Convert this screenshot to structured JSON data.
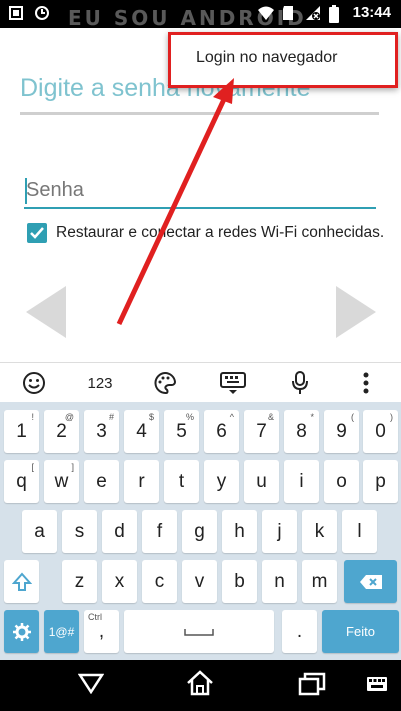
{
  "status_bar": {
    "time": "13:44",
    "left_icons": [
      "notification-icon",
      "clock-alarm-icon"
    ],
    "right_icons": [
      "wifi-icon",
      "sd-card-icon",
      "signal-no-sim-icon",
      "battery-icon"
    ],
    "watermark": "EU SOU ANDROID"
  },
  "app": {
    "title": "Digite a senha novamente",
    "password_placeholder": "Senha",
    "wifi_checkbox_label": "Restaurar e conectar a redes Wi-Fi conhecidas.",
    "wifi_checkbox_checked": true
  },
  "popup_menu": {
    "items": [
      "Login no navegador"
    ]
  },
  "keyboard_toolbar": {
    "numbers_label": "123",
    "icons": [
      "emoji-icon",
      "palette-icon",
      "keyboard-hide-icon",
      "microphone-icon",
      "more-vert-icon"
    ]
  },
  "keyboard": {
    "row1": [
      "1",
      "2",
      "3",
      "4",
      "5",
      "6",
      "7",
      "8",
      "9",
      "0"
    ],
    "row1_hints": [
      "!",
      "@",
      "#",
      "$",
      "%",
      "^",
      "&",
      "*",
      "(",
      ")"
    ],
    "row2": [
      "q",
      "w",
      "e",
      "r",
      "t",
      "y",
      "u",
      "i",
      "o",
      "p"
    ],
    "row2_hints": [
      "[",
      "]",
      "",
      "",
      "",
      "",
      "",
      "",
      "",
      ""
    ],
    "row3": [
      "a",
      "s",
      "d",
      "f",
      "g",
      "h",
      "j",
      "k",
      "l"
    ],
    "row4": [
      "z",
      "x",
      "c",
      "v",
      "b",
      "n",
      "m"
    ],
    "symbols_label": "1@#",
    "comma": ",",
    "comma_hint": "Ctrl",
    "period": ".",
    "enter_label": "Feito"
  },
  "colors": {
    "accent": "#2f9fb3",
    "title": "#7fc3cf",
    "keyboard_bg": "#d6e1ea",
    "key_blue": "#4ea6cf",
    "highlight": "#e02020"
  }
}
